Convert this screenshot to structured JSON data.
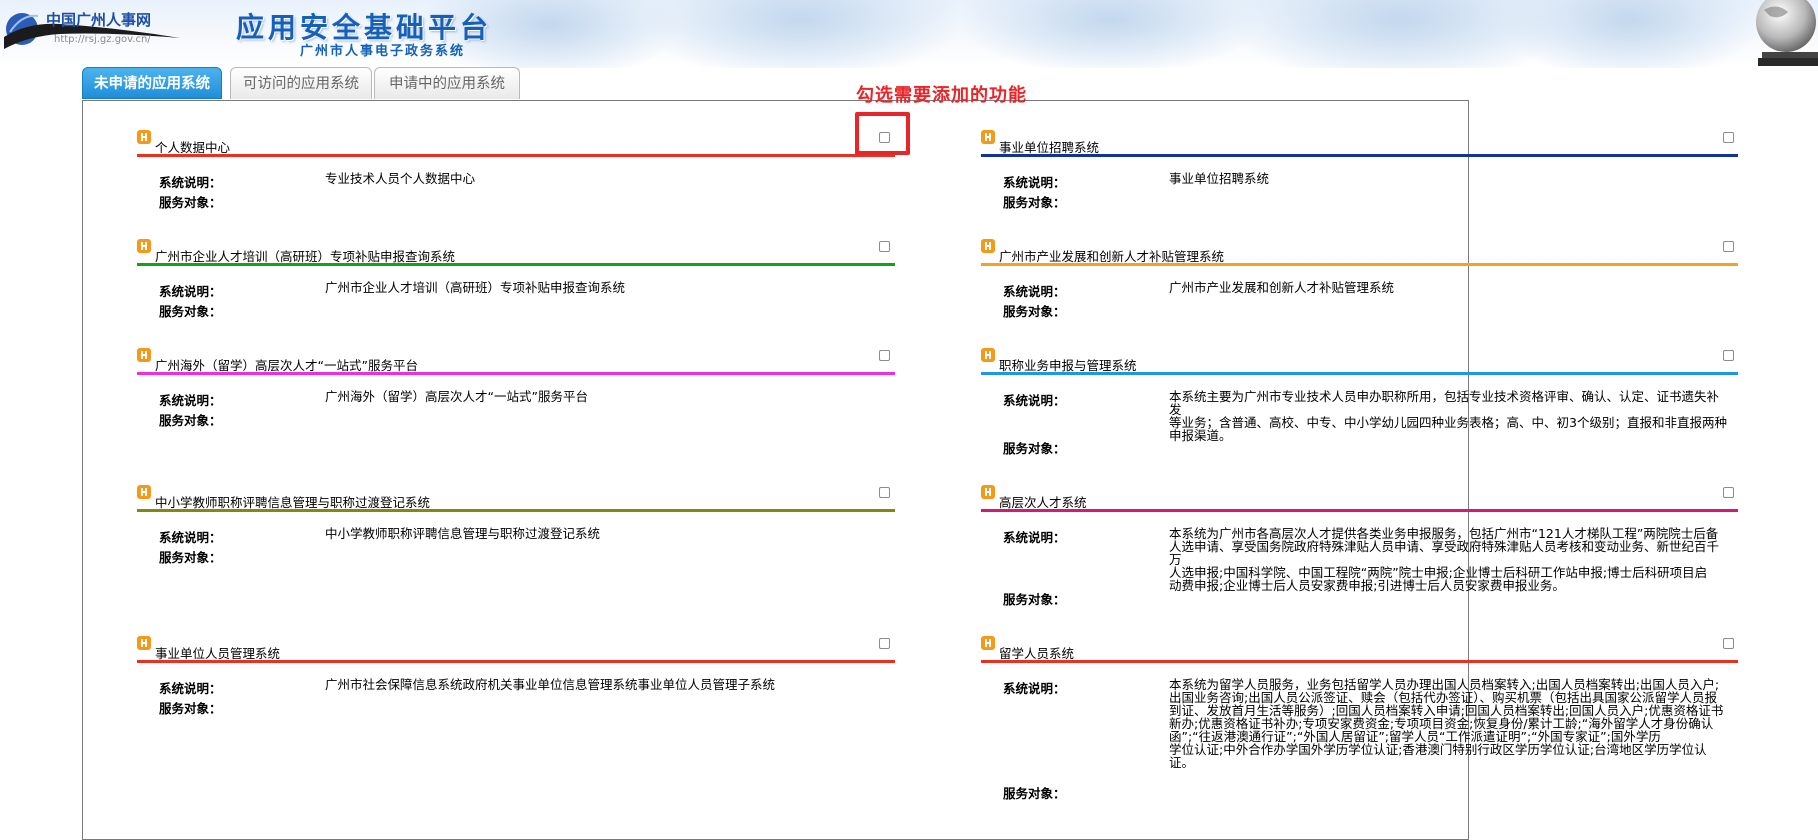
{
  "header": {
    "logo_cn": "中国广州人事网",
    "logo_url": "http://rsj.gz.gov.cn/",
    "platform_title": "应用安全基础平台",
    "platform_subtitle": "广州市人事电子政务系统"
  },
  "tabs": [
    {
      "label": "未申请的应用系统",
      "active": true
    },
    {
      "label": "可访问的应用系统",
      "active": false
    },
    {
      "label": "申请中的应用系统",
      "active": false
    }
  ],
  "annotation": {
    "text": "勾选需要添加的功能",
    "color": "#e8262a"
  },
  "labels": {
    "description": "系统说明：",
    "service": "服务对象："
  },
  "systems_left": [
    {
      "title": "个人数据中心",
      "line_color": "#e8311f",
      "description": "专业技术人员个人数据中心",
      "service": "",
      "checked": false
    },
    {
      "title": "广州市企业人才培训（高研班）专项补贴申报查询系统",
      "line_color": "#13a317",
      "description": "广州市企业人才培训（高研班）专项补贴申报查询系统",
      "service": "",
      "checked": false
    },
    {
      "title": "广州海外（留学）高层次人才“一站式”服务平台",
      "line_color": "#ee2ee0",
      "description": "广州海外（留学）高层次人才“一站式”服务平台",
      "service": "",
      "checked": false
    },
    {
      "title": "中小学教师职称评聘信息管理与职称过渡登记系统",
      "line_color": "#7f8a12",
      "description": "中小学教师职称评聘信息管理与职称过渡登记系统",
      "service": "",
      "checked": false
    },
    {
      "title": "事业单位人员管理系统",
      "line_color": "#e8311f",
      "description": "广州市社会保障信息系统政府机关事业单位信息管理系统事业单位人员管理子系统",
      "service": "",
      "checked": false
    }
  ],
  "systems_right": [
    {
      "title": "事业单位招聘系统",
      "line_color": "#10349a",
      "description": "事业单位招聘系统",
      "service": "",
      "checked": false
    },
    {
      "title": "广州市产业发展和创新人才补贴管理系统",
      "line_color": "#f5a21f",
      "description": "广州市产业发展和创新人才补贴管理系统",
      "service": "",
      "checked": false
    },
    {
      "title": "职称业务申报与管理系统",
      "line_color": "#1f97e6",
      "description": "本系统主要为广州市专业技术人员申办职称所用，包括专业技术资格评审、确认、认定、证书遗失补发\n等业务；含普通、高校、中专、中小学幼儿园四种业务表格；高、中、初3个级别；直报和非直报两种\n申报渠道。",
      "service": "",
      "checked": false
    },
    {
      "title": "高层次人才系统",
      "line_color": "#d41a72",
      "description": "本系统为广州市各高层次人才提供各类业务申报服务，包括广州市“121人才梯队工程”两院院士后备\n人选申请、享受国务院政府特殊津贴人员申请、享受政府特殊津贴人员考核和变动业务、新世纪百千万\n人选申报;中国科学院、中国工程院“两院”院士申报;企业博士后科研工作站申报;博士后科研项目启\n动费申报;企业博士后人员安家费申报;引进博士后人员安家费申报业务。",
      "service": "",
      "checked": false
    },
    {
      "title": "留学人员系统",
      "line_color": "#e8311f",
      "description": "本系统为留学人员服务，业务包括留学人员办理出国人员档案转入;出国人员档案转出;出国人员入户;\n出国业务咨询;出国人员公派签证、赎会（包括代办签证）、购买机票（包括出具国家公派留学人员报\n到证、发放首月生活等服务）;回国人员档案转入申请;回国人员档案转出;回国人员入户;优惠资格证书\n新办;优惠资格证书补办;专项安家费资金;专项项目资金;恢复身份/累计工龄;“海外留学人才身份确认\n函”;“往返港澳通行证”;“外国人居留证”;留学人员“工作派遣证明”;“外国专家证”;国外学历\n学位认证;中外合作办学国外学历学位认证;香港澳门特别行政区学历学位认证;台湾地区学历学位认\n证。",
      "service": "",
      "checked": false
    }
  ]
}
